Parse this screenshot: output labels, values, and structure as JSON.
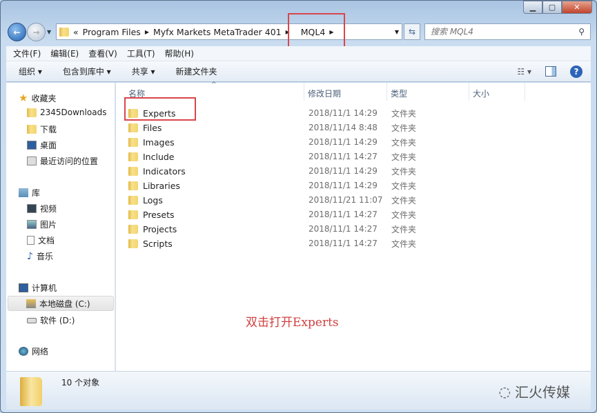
{
  "address": {
    "overflow": "«",
    "crumbs": [
      "Program Files",
      "Myfx Markets MetaTrader 401",
      "MQL4"
    ]
  },
  "search": {
    "placeholder": "搜索 MQL4"
  },
  "menu": [
    "文件(F)",
    "编辑(E)",
    "查看(V)",
    "工具(T)",
    "帮助(H)"
  ],
  "toolbar": {
    "organize": "组织 ▾",
    "include_library": "包含到库中 ▾",
    "share": "共享 ▾",
    "new_folder": "新建文件夹"
  },
  "sidebar": {
    "favorites": "收藏夹",
    "fav_items": [
      "2345Downloads",
      "下载",
      "桌面",
      "最近访问的位置"
    ],
    "libraries": "库",
    "lib_items": [
      "视频",
      "图片",
      "文档",
      "音乐"
    ],
    "computer": "计算机",
    "drives": [
      "本地磁盘 (C:)",
      "软件 (D:)"
    ],
    "network": "网络"
  },
  "columns": {
    "name": "名称",
    "date": "修改日期",
    "type": "类型",
    "size": "大小"
  },
  "files": [
    {
      "name": "Experts",
      "date": "2018/11/1 14:29",
      "type": "文件夹"
    },
    {
      "name": "Files",
      "date": "2018/11/14 8:48",
      "type": "文件夹"
    },
    {
      "name": "Images",
      "date": "2018/11/1 14:29",
      "type": "文件夹"
    },
    {
      "name": "Include",
      "date": "2018/11/1 14:27",
      "type": "文件夹"
    },
    {
      "name": "Indicators",
      "date": "2018/11/1 14:29",
      "type": "文件夹"
    },
    {
      "name": "Libraries",
      "date": "2018/11/1 14:29",
      "type": "文件夹"
    },
    {
      "name": "Logs",
      "date": "2018/11/21 11:07",
      "type": "文件夹"
    },
    {
      "name": "Presets",
      "date": "2018/11/1 14:27",
      "type": "文件夹"
    },
    {
      "name": "Projects",
      "date": "2018/11/1 14:27",
      "type": "文件夹"
    },
    {
      "name": "Scripts",
      "date": "2018/11/1 14:27",
      "type": "文件夹"
    }
  ],
  "annotation": "双击打开Experts",
  "status": {
    "count": "10 个对象"
  },
  "watermark": "汇火传媒",
  "colors": {
    "highlight": "#d9454a"
  }
}
